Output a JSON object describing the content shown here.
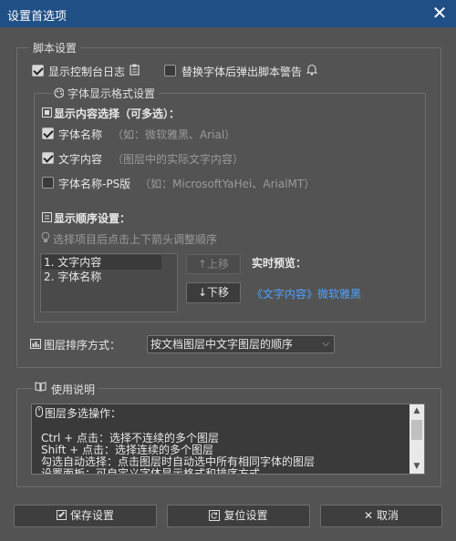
{
  "window": {
    "title": "设置首选项",
    "close": "✕"
  },
  "script_settings": {
    "legend": "脚本设置",
    "show_console_log": {
      "label": "显示控制台日志",
      "checked": true
    },
    "replace_warning": {
      "label": "替换字体后弹出脚本警告",
      "checked": false
    }
  },
  "font_display": {
    "legend": "字体显示格式设置",
    "content_heading": "显示内容选择（可多选）：",
    "options": [
      {
        "label": "字体名称",
        "hint": "（如：微软雅黑、Arial）",
        "checked": true
      },
      {
        "label": "文字内容",
        "hint": "（图层中的实际文字内容）",
        "checked": true
      },
      {
        "label": "字体名称-PS版",
        "hint": "（如：MicrosoftYaHei、ArialMT）",
        "checked": false
      }
    ],
    "order_heading": "显示顺序设置：",
    "order_hint": "选择项目后点击上下箭头调整顺序",
    "order_list": [
      "1. 文字内容",
      "2. 字体名称"
    ],
    "up_button": "↑上移",
    "down_button": "↓下移",
    "preview_label": "实时预览：",
    "preview_value": "《文字内容》微软雅黑"
  },
  "layer_sort": {
    "label": "图层排序方式：",
    "selected": "按文档图层中文字图层的顺序"
  },
  "usage": {
    "legend": "使用说明",
    "lines": [
      "图层多选操作：",
      "",
      "Ctrl + 点击：选择不连续的多个图层",
      "Shift + 点击：选择连续的多个图层",
      "勾选自动选择：点击图层时自动选中所有相同字体的图层",
      "设置面板：可自定义字体显示格式和排序方式"
    ]
  },
  "footer": {
    "save": "保存设置",
    "reset": "复位设置",
    "cancel": "取消"
  }
}
